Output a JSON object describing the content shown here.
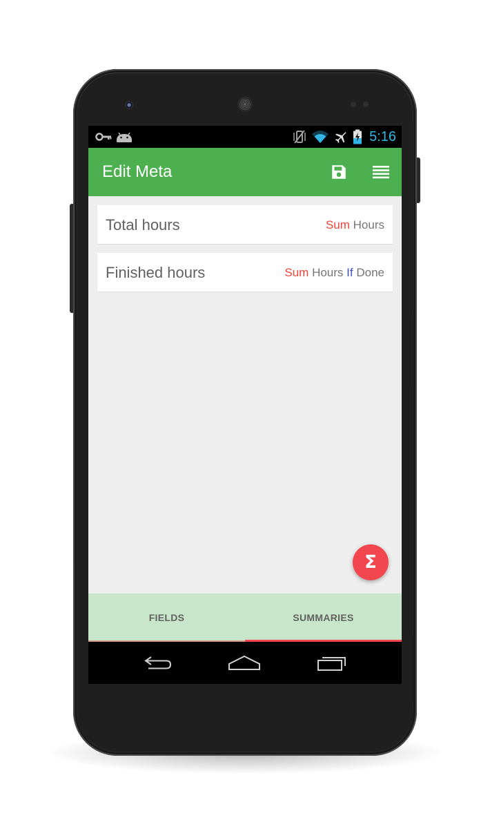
{
  "status_bar": {
    "time": "5:16",
    "left_icons": [
      "vpn-key-icon",
      "android-debug-icon"
    ],
    "right_icons": [
      "vibrate-off-icon",
      "wifi-icon",
      "airplane-mode-icon",
      "battery-charging-icon"
    ]
  },
  "app_bar": {
    "title": "Edit Meta",
    "actions": [
      "save-icon",
      "list-menu-icon"
    ]
  },
  "summaries": [
    {
      "label": "Total hours",
      "formula": {
        "function": "Sum",
        "field": "Hours",
        "condition": "",
        "condition_field": ""
      }
    },
    {
      "label": "Finished hours",
      "formula": {
        "function": "Sum",
        "field": "Hours",
        "condition": "If",
        "condition_field": "Done"
      }
    }
  ],
  "fab": {
    "symbol": "Σ",
    "icon": "sigma-icon"
  },
  "tabs": [
    {
      "label": "FIELDS",
      "selected": false
    },
    {
      "label": "SUMMARIES",
      "selected": true
    }
  ],
  "nav_bar": {
    "icons": [
      "back-icon",
      "home-icon",
      "recents-icon"
    ]
  },
  "colors": {
    "app_bar": "#4caf50",
    "status_time": "#33b5e5",
    "accent": "#f2474e",
    "function_token": "#f44336",
    "condition_token": "#3f51b5",
    "tab_bar": "#c8e6c9",
    "content_bg": "#eeeeee"
  }
}
